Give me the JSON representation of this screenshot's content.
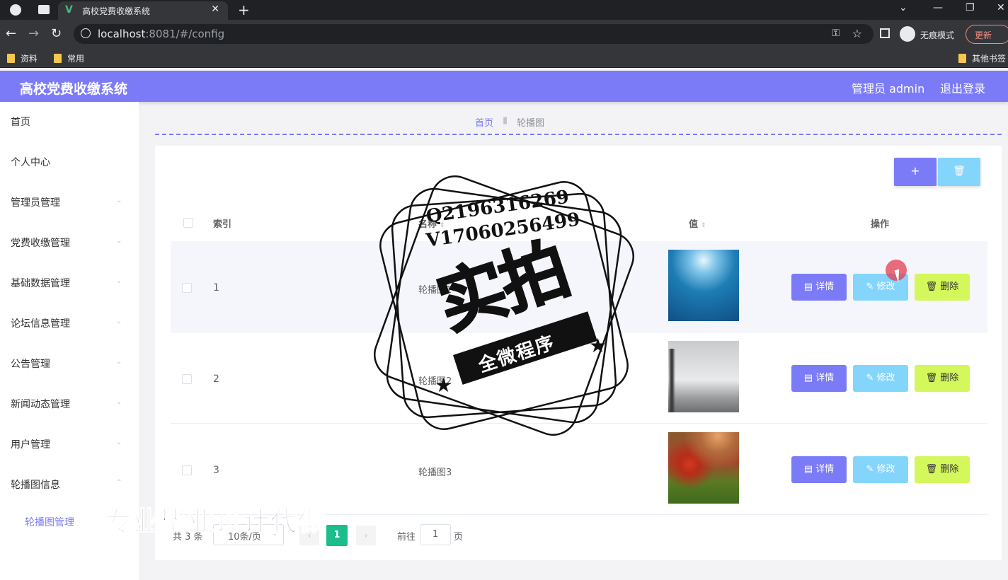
{
  "browser": {
    "tab_title": "高校党费收缴系统",
    "tab_new": "+",
    "url_host": "localhost",
    "url_rest": ":8081/#/config",
    "incognito_label": "无痕模式",
    "update_label": "更新",
    "bookmarks": [
      "资料",
      "常用",
      "其他书签"
    ]
  },
  "header": {
    "title": "高校党费收缴系统",
    "admin_label": "管理员 admin",
    "logout_label": "退出登录"
  },
  "sidebar": {
    "items": [
      {
        "label": "首页"
      },
      {
        "label": "个人中心"
      },
      {
        "label": "管理员管理"
      },
      {
        "label": "党费收缴管理"
      },
      {
        "label": "基础数据管理"
      },
      {
        "label": "论坛信息管理"
      },
      {
        "label": "公告管理"
      },
      {
        "label": "新闻动态管理"
      },
      {
        "label": "用户管理"
      },
      {
        "label": "轮播图信息"
      }
    ],
    "sub_item": "轮播图管理"
  },
  "breadcrumb": {
    "home": "首页",
    "current": "轮播图"
  },
  "toolbar": {
    "add_label": "+",
    "delete_icon": "trash-icon"
  },
  "table": {
    "headers": {
      "index": "索引",
      "name": "名称",
      "value": "值",
      "actions": "操作"
    },
    "rows": [
      {
        "index": "1",
        "name": "轮播图1",
        "image": "underwater-blue"
      },
      {
        "index": "2",
        "name": "轮播图2",
        "image": "eiffel-tower"
      },
      {
        "index": "3",
        "name": "轮播图3",
        "image": "tulip-field"
      }
    ],
    "actions": {
      "detail": "详情",
      "edit": "修改",
      "delete": "删除"
    }
  },
  "pagination": {
    "total": "共 3 条",
    "page_size": "10条/页",
    "current_page": "1",
    "goto_label": "前往",
    "goto_value": "1",
    "page_unit": "页"
  },
  "overlay": {
    "stamp_qq": "Q2196316269",
    "stamp_vx": "V17060256499",
    "stamp_big": "实拍",
    "stamp_ribbon": "全微程序",
    "watermark": "专业毕业设计代做"
  }
}
